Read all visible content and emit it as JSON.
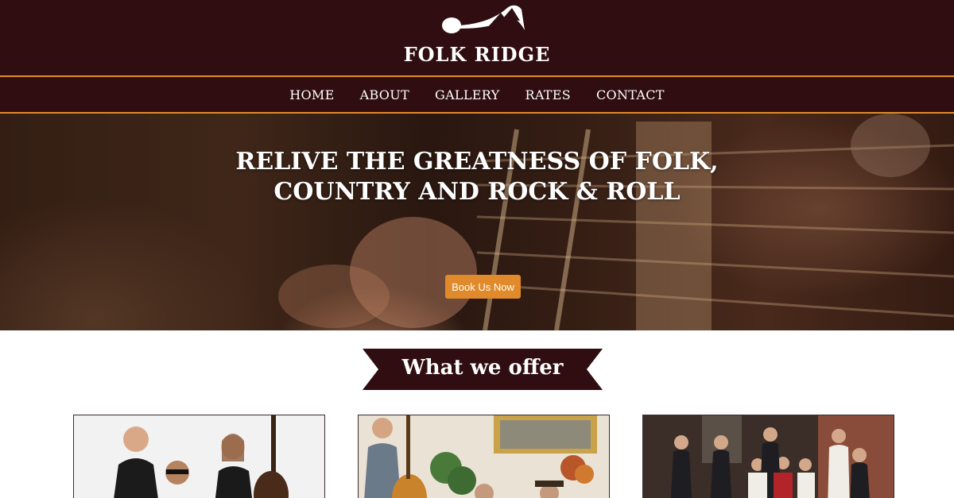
{
  "brand": {
    "name": "FOLK RIDGE",
    "logo_icon": "music-note-mountain-icon"
  },
  "nav": {
    "items": [
      {
        "label": "HOME"
      },
      {
        "label": "ABOUT"
      },
      {
        "label": "GALLERY"
      },
      {
        "label": "RATES"
      },
      {
        "label": "CONTACT"
      }
    ]
  },
  "hero": {
    "headline_line1": "RELIVE THE GREATNESS OF FOLK,",
    "headline_line2": "COUNTRY AND ROCK & ROLL",
    "cta_label": "Book Us Now"
  },
  "section": {
    "title": "What we offer"
  },
  "cards": [
    {
      "image": "trio-with-upright-bass-photo"
    },
    {
      "image": "band-in-living-room-photo"
    },
    {
      "image": "big-band-group-photo"
    }
  ],
  "colors": {
    "header_bg": "#2f0d10",
    "accent": "#e08a2b",
    "text_light": "#ffffff"
  }
}
